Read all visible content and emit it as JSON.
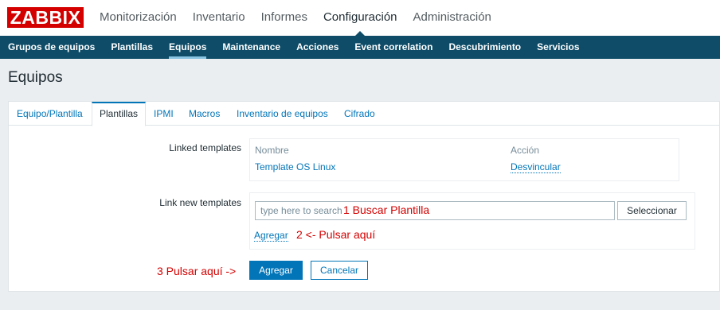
{
  "header": {
    "logo_text": "ZABBIX",
    "nav": [
      "Monitorización",
      "Inventario",
      "Informes",
      "Configuración",
      "Administración"
    ],
    "active_nav": "Configuración"
  },
  "subnav": {
    "items": [
      "Grupos de equipos",
      "Plantillas",
      "Equipos",
      "Maintenance",
      "Acciones",
      "Event correlation",
      "Descubrimiento",
      "Servicios"
    ],
    "active": "Equipos"
  },
  "page": {
    "title": "Equipos"
  },
  "tabs": {
    "items": [
      "Equipo/Plantilla",
      "Plantillas",
      "IPMI",
      "Macros",
      "Inventario de equipos",
      "Cifrado"
    ],
    "active": "Plantillas"
  },
  "linked_templates": {
    "label": "Linked templates",
    "col_name": "Nombre",
    "col_action": "Acción",
    "rows": [
      {
        "name": "Template OS Linux",
        "action": "Desvincular"
      }
    ]
  },
  "link_new": {
    "label": "Link new templates",
    "placeholder": "type here to search",
    "select_button": "Seleccionar",
    "add_link": "Agregar"
  },
  "annotations": {
    "step1": "1 Buscar Plantilla",
    "step2": "2 <- Pulsar aquí",
    "step3": "3 Pulsar aquí ->"
  },
  "buttons": {
    "add": "Agregar",
    "cancel": "Cancelar"
  },
  "colors": {
    "brand_red": "#d40000",
    "subnav_bg": "#0e4c68",
    "link_blue": "#0275b8",
    "annotation_red": "#d40000"
  }
}
